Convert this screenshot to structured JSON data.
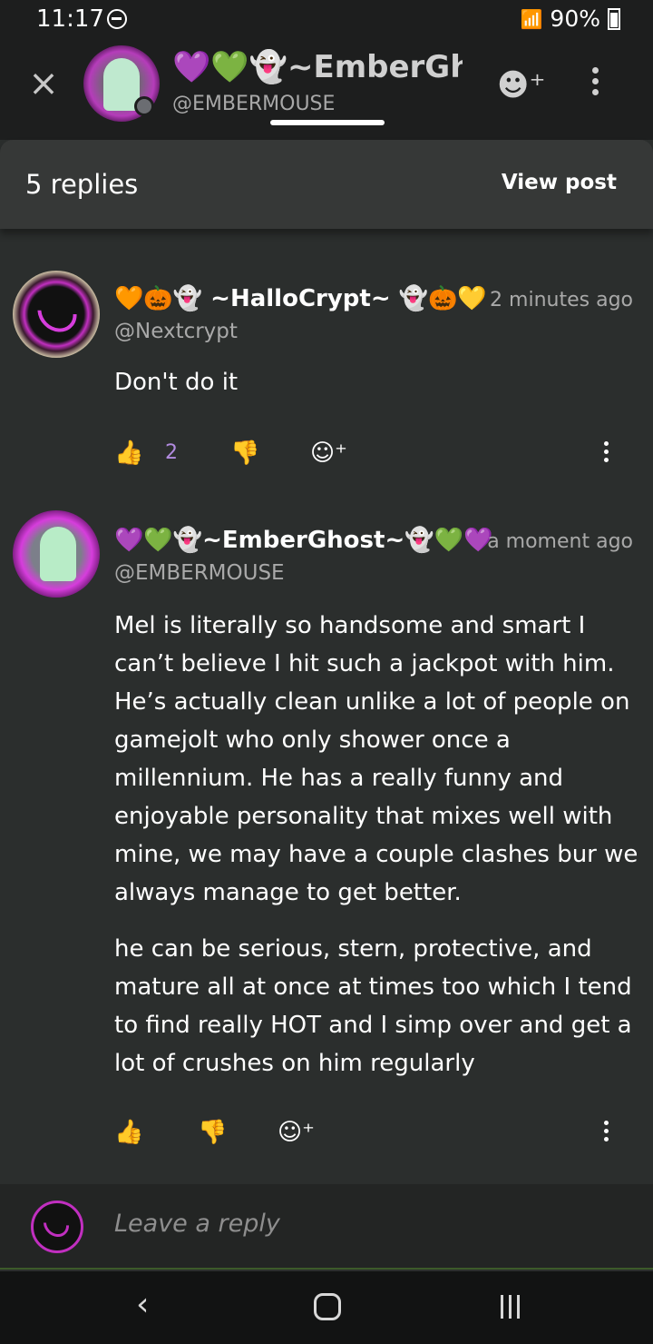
{
  "status_bar": {
    "time": "11:17",
    "battery": "90%"
  },
  "header": {
    "close_icon": "close-icon",
    "name": "💜💚👻~EmberGh",
    "handle": "@EMBERMOUSE",
    "emoji_button_icon": "add-emoji-icon",
    "more_icon": "more-vertical-icon"
  },
  "replies_header": {
    "count_label": "5 replies",
    "view_post_label": "View post"
  },
  "comments": [
    {
      "name": "🧡🎃👻 ~HalloCrypt~ 👻🎃💛",
      "time": "2 minutes ago",
      "handle": "@Nextcrypt",
      "body": [
        "Don't do it"
      ],
      "like_count": "2"
    },
    {
      "name": "💜💚👻~EmberGhost~👻💚💜",
      "time": "a moment ago",
      "handle": "@EMBERMOUSE",
      "body": [
        "Mel is literally so handsome and smart I can’t believe I hit such a jackpot with him. He’s actually clean unlike a lot of people on gamejolt who only shower once a millennium. He has a really funny and enjoyable personality that mixes well with mine, we may have a couple clashes bur we always manage to get better.",
        "he can be serious, stern, protective, and mature all at once at times too which I tend to find really HOT and I simp over and get a lot of crushes on him regularly"
      ],
      "like_count": ""
    }
  ],
  "reply_bar": {
    "placeholder": "Leave a reply"
  },
  "icons": {
    "like": "👍",
    "dislike": "👎",
    "react": "☺+"
  },
  "colors": {
    "accent_purple": "#b28be0",
    "avatar_pink": "#c12fc0"
  }
}
